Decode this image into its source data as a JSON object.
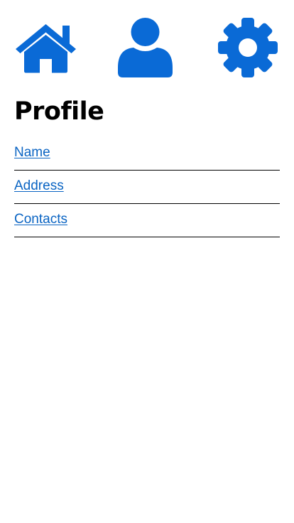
{
  "nav": {
    "items": [
      {
        "icon": "home-icon"
      },
      {
        "icon": "user-icon"
      },
      {
        "icon": "gear-icon"
      }
    ]
  },
  "colors": {
    "accent": "#0a6ad6",
    "link": "#0a64c3",
    "text": "#000000",
    "divider": "#000000",
    "background": "#ffffff"
  },
  "page": {
    "title": "Profile"
  },
  "menu": {
    "items": [
      {
        "label": "Name"
      },
      {
        "label": "Address"
      },
      {
        "label": "Contacts"
      }
    ]
  }
}
